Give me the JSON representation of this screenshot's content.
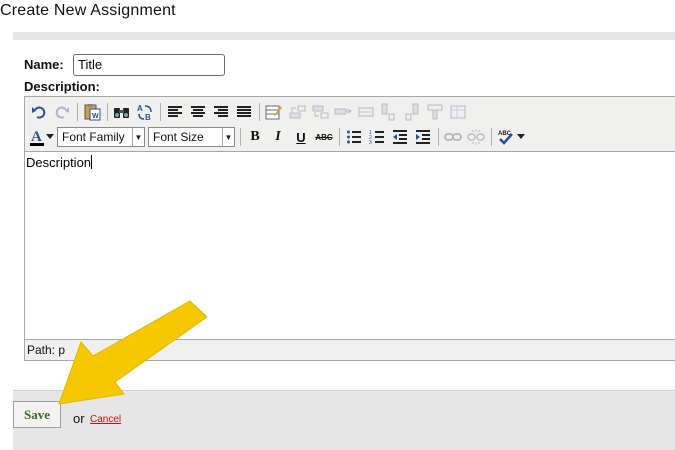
{
  "page": {
    "title": "Create New Assignment"
  },
  "form": {
    "name_label": "Name:",
    "name_value": "Title",
    "description_label": "Description:"
  },
  "editor": {
    "font_family_label": "Font Family",
    "font_size_label": "Font Size",
    "bold_label": "B",
    "italic_label": "I",
    "underline_label": "U",
    "strike_label": "ABC",
    "content_text": "Description",
    "status_text": "Path: p"
  },
  "actions": {
    "save_label": "Save",
    "or_text": "or",
    "cancel_label": "Cancel"
  },
  "colors": {
    "annotation_arrow": "#f5c800",
    "save_text": "#3c6d1c",
    "cancel_link": "#cc1111",
    "toolbar_icon": "#2a4f9c"
  },
  "icons": {
    "row1": [
      "undo-icon",
      "redo-icon",
      "paste-word-icon",
      "find-icon",
      "replace-icon",
      "align-left-icon",
      "align-center-icon",
      "align-right-icon",
      "align-justify-icon",
      "table-edit-icon",
      "row-before-icon",
      "row-after-icon",
      "delete-row-icon",
      "merge-cells-icon",
      "col-before-icon",
      "col-after-icon",
      "delete-col-icon",
      "table-props-icon"
    ],
    "row2": [
      "font-color-icon",
      "bullet-list-icon",
      "numbered-list-icon",
      "outdent-icon",
      "indent-icon",
      "link-icon",
      "unlink-icon",
      "spellcheck-icon"
    ]
  }
}
